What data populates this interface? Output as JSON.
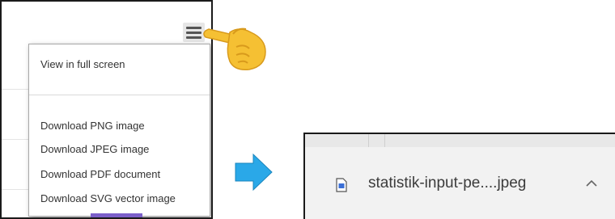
{
  "export_menu": {
    "button_icon": "hamburger-menu-icon",
    "items": [
      {
        "label": "View in full screen"
      },
      {
        "label": "Download PNG image"
      },
      {
        "label": "Download JPEG image"
      },
      {
        "label": "Download PDF document"
      },
      {
        "label": "Download SVG vector image"
      }
    ]
  },
  "download_bar": {
    "file_icon": "image-file-icon",
    "file_name": "statistik-input-pe....jpeg",
    "chevron_icon": "chevron-up-icon"
  },
  "colors": {
    "arrow": "#2aa8e8",
    "hand": "#f5c033",
    "accent_strip": "#7b5fc9"
  }
}
